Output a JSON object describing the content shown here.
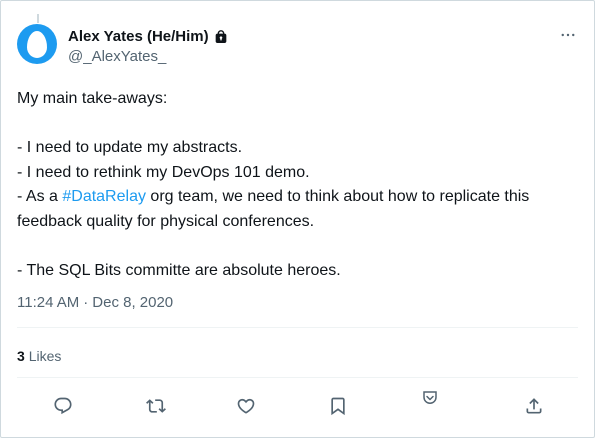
{
  "author": {
    "name": "Alex Yates (He/Him)",
    "handle": "@_AlexYates_",
    "protected_icon": "lock-icon"
  },
  "tweet": {
    "intro": "My main take-aways:",
    "line1": "- I need to update my abstracts.",
    "line2": "- I need to rethink my DevOps 101 demo.",
    "line3_prefix": "- As a ",
    "line3_hashtag": "#DataRelay",
    "line3_suffix": " org team, we need to think about how to replicate this feedback quality for physical conferences.",
    "line4": "- The SQL Bits committe are absolute heroes."
  },
  "meta": {
    "time": "11:24 AM",
    "separator": "·",
    "date": "Dec 8, 2020"
  },
  "stats": {
    "likes_count": "3",
    "likes_label": "Likes"
  },
  "actions": [
    "reply-icon",
    "retweet-icon",
    "like-icon",
    "bookmark-icon",
    "pocket-icon",
    "share-icon"
  ],
  "colors": {
    "accent": "#1d9bf0",
    "secondary_text": "#536471",
    "border": "#cfd9de"
  }
}
